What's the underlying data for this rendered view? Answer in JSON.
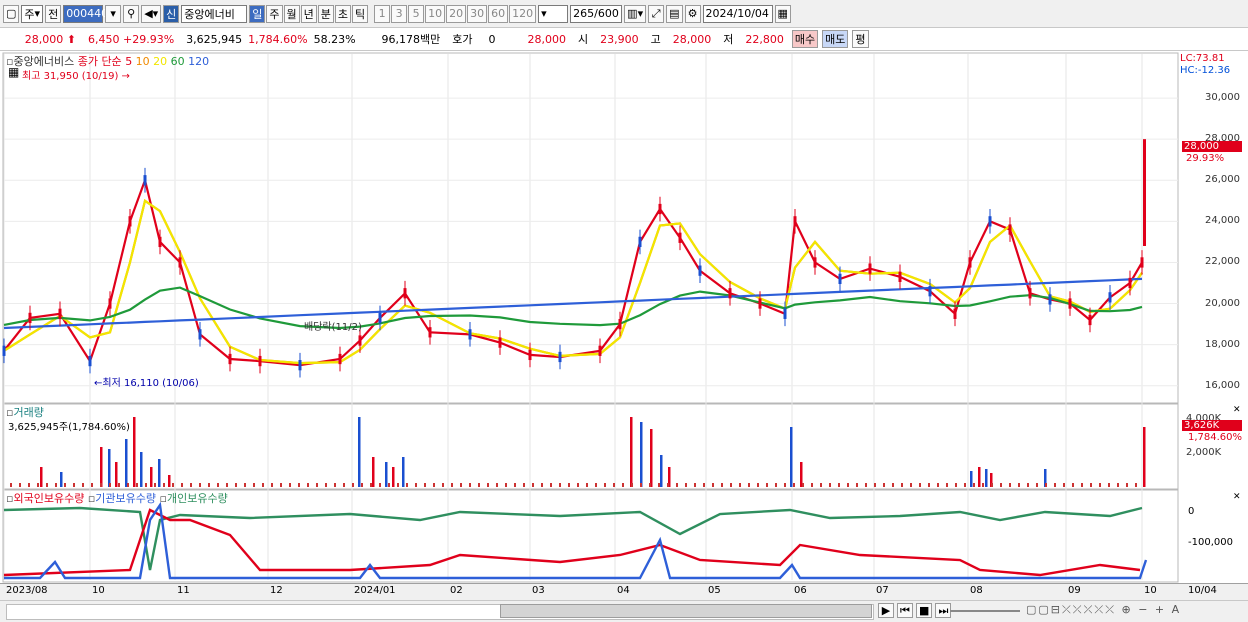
{
  "toolbar": {
    "mode": "주",
    "prev_label": "전",
    "code": "000440",
    "name_tag": "신",
    "stock_name": "중앙에너비",
    "periods": [
      "일",
      "주",
      "월",
      "년",
      "분",
      "초",
      "틱"
    ],
    "numbers": [
      "1",
      "3",
      "5",
      "10",
      "20",
      "30",
      "60",
      "120"
    ],
    "count_value": "265",
    "count_total": "/600",
    "date": "2024/10/04"
  },
  "info": {
    "price": "28,000",
    "change": "6,450",
    "change_pct": "+29.93%",
    "volume": "3,625,945",
    "volume_pct": "1,784.60%",
    "turnover": "58.23%",
    "amount": "96,178백만",
    "hoga_label": "호가",
    "hoga_value": "0",
    "cur": "28,000",
    "open_label": "시",
    "open": "23,900",
    "high_label": "고",
    "high": "28,000",
    "low_label": "저",
    "low": "22,800",
    "buy_label": "매수",
    "sell_label": "매도",
    "eval_label": "평"
  },
  "main_chart": {
    "title": "중앙에너비스",
    "price_label": "종가 단순",
    "ma_labels": [
      "5",
      "10",
      "20",
      "60",
      "120"
    ],
    "ma_colors": [
      "#e0001b",
      "#f08a00",
      "#f2e600",
      "#1f9a3a",
      "#2e5fd8"
    ],
    "high_note": "최고 31,950 (10/19)",
    "low_note": "최저 16,110 (10/06)",
    "dividend_note": "배당락(11/2)",
    "lc": "LC:73.81",
    "hc": "HC:-12.36",
    "current_price_label": "28,000",
    "current_pct_label": "29.93%",
    "y_ticks": [
      "30,000",
      "28,000",
      "26,000",
      "24,000",
      "22,000",
      "20,000",
      "18,000",
      "16,000"
    ]
  },
  "volume_chart": {
    "title": "거래량",
    "summary": "3,625,945주(1,784.60%)",
    "y_ticks": [
      "4,000K",
      "2,000K"
    ],
    "current_label": "3,626K",
    "current_pct": "1,784.60%"
  },
  "holdings_chart": {
    "series": [
      "외국인보유수량",
      "기관보유수량",
      "개인보유수량"
    ],
    "y_ticks": [
      "0",
      "-100,000"
    ]
  },
  "x_axis": [
    "2023/08",
    "10",
    "11",
    "12",
    "2024/01",
    "02",
    "03",
    "04",
    "05",
    "06",
    "07",
    "08",
    "09",
    "10",
    "10/04"
  ],
  "chart_data": {
    "type": "line",
    "title": "",
    "ylim": [
      15500,
      31950
    ]
  }
}
